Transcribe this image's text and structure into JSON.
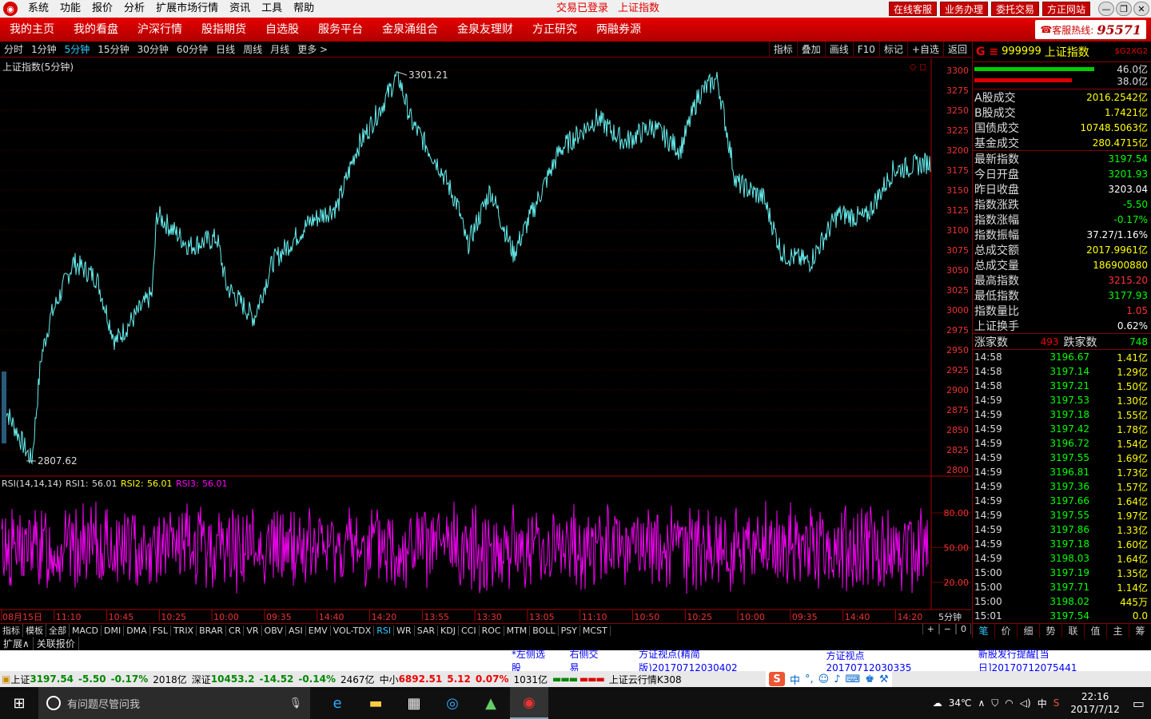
{
  "menubar": {
    "items": [
      "系统",
      "功能",
      "报价",
      "分析",
      "扩展市场行情",
      "资讯",
      "工具",
      "帮助"
    ],
    "status": "交易已登录",
    "security": "上证指数",
    "buttons": [
      "在线客服",
      "业务办理",
      "委托交易",
      "方正网站"
    ]
  },
  "navbar": {
    "items": [
      "我的主页",
      "我的看盘",
      "沪深行情",
      "股指期货",
      "自选股",
      "服务平台",
      "金泉涌组合",
      "金泉友理财",
      "方正研究",
      "两融券源"
    ],
    "hotline_label": "客服热线:",
    "hotline_num": "95571"
  },
  "periods": {
    "items": [
      "分时",
      "1分钟",
      "5分钟",
      "15分钟",
      "30分钟",
      "60分钟",
      "日线",
      "周线",
      "月线",
      "更多 >"
    ],
    "active": 2
  },
  "tools": [
    "指标",
    "叠加",
    "画线",
    "F10",
    "标记",
    "+自选",
    "返回"
  ],
  "chart_data": {
    "type": "line",
    "title": "上证指数(5分钟)",
    "y_ticks": [
      3300,
      3275,
      3250,
      3225,
      3200,
      3175,
      3150,
      3125,
      3100,
      3075,
      3050,
      3025,
      3000,
      2975,
      2950,
      2925,
      2900,
      2875,
      2850,
      2825,
      2800
    ],
    "ylim": [
      2800,
      3300
    ],
    "high_label": "3301.21",
    "low_label": "2807.62",
    "waypoints": [
      [
        0,
        2880
      ],
      [
        0.03,
        2810
      ],
      [
        0.04,
        2940
      ],
      [
        0.05,
        2990
      ],
      [
        0.075,
        3060
      ],
      [
        0.1,
        3040
      ],
      [
        0.12,
        2960
      ],
      [
        0.16,
        3020
      ],
      [
        0.165,
        3120
      ],
      [
        0.2,
        3080
      ],
      [
        0.23,
        3090
      ],
      [
        0.24,
        3030
      ],
      [
        0.27,
        2990
      ],
      [
        0.29,
        3060
      ],
      [
        0.33,
        3110
      ],
      [
        0.36,
        3130
      ],
      [
        0.38,
        3200
      ],
      [
        0.41,
        3260
      ],
      [
        0.425,
        3295
      ],
      [
        0.44,
        3235
      ],
      [
        0.47,
        3180
      ],
      [
        0.49,
        3130
      ],
      [
        0.5,
        3080
      ],
      [
        0.525,
        3150
      ],
      [
        0.55,
        3070
      ],
      [
        0.6,
        3200
      ],
      [
        0.64,
        3240
      ],
      [
        0.67,
        3210
      ],
      [
        0.7,
        3230
      ],
      [
        0.73,
        3200
      ],
      [
        0.75,
        3270
      ],
      [
        0.77,
        3290
      ],
      [
        0.79,
        3160
      ],
      [
        0.82,
        3140
      ],
      [
        0.84,
        3070
      ],
      [
        0.87,
        3060
      ],
      [
        0.9,
        3120
      ],
      [
        0.93,
        3115
      ],
      [
        0.96,
        3175
      ],
      [
        1.0,
        3185
      ]
    ],
    "x_labels": [
      "08月15日",
      "11:10",
      "10:45",
      "10:25",
      "10:00",
      "09:35",
      "14:40",
      "14:20",
      "13:55",
      "13:30",
      "13:05",
      "11:10",
      "10:50",
      "10:25",
      "10:00",
      "09:35",
      "14:40",
      "14:20"
    ],
    "x_unit": "5分钟",
    "rsi": {
      "label": "RSI(14,14,14)",
      "rsi1_label": "RSI1:",
      "rsi1": "56.01",
      "rsi2_label": "RSI2:",
      "rsi2": "56.01",
      "rsi3_label": "RSI3:",
      "rsi3": "56.01",
      "ticks": [
        "80.00",
        "50.00",
        "20.00"
      ]
    }
  },
  "quote": {
    "code": "999999",
    "name": "上证指数",
    "tag": "$G2XG2",
    "bar1": "46.0亿",
    "bar2": "38.0亿",
    "turnover": [
      [
        "A股成交",
        "2016.2542亿"
      ],
      [
        "B股成交",
        "1.7421亿"
      ],
      [
        "国债成交",
        "10748.5063亿"
      ],
      [
        "基金成交",
        "280.4715亿"
      ]
    ],
    "stats": [
      [
        "最新指数",
        "3197.54",
        "g"
      ],
      [
        "今日开盘",
        "3201.93",
        "g"
      ],
      [
        "昨日收盘",
        "3203.04",
        "w"
      ],
      [
        "指数涨跌",
        "-5.50",
        "g"
      ],
      [
        "指数涨幅",
        "-0.17%",
        "g"
      ],
      [
        "指数振幅",
        "37.27/1.16%",
        "w"
      ],
      [
        "总成交额",
        "2017.9961亿",
        "y"
      ],
      [
        "总成交量",
        "186900880",
        "y"
      ],
      [
        "最高指数",
        "3215.20",
        "r"
      ],
      [
        "最低指数",
        "3177.93",
        "g"
      ],
      [
        "指数量比",
        "1.05",
        "r"
      ],
      [
        "上证换手",
        "0.62%",
        "w"
      ]
    ],
    "up_label": "涨家数",
    "up": "493",
    "down_label": "跌家数",
    "down": "748",
    "ticks": [
      [
        "14:58",
        "3196.67",
        "1.41亿"
      ],
      [
        "14:58",
        "3197.14",
        "1.29亿"
      ],
      [
        "14:58",
        "3197.21",
        "1.50亿"
      ],
      [
        "14:59",
        "3197.53",
        "1.30亿"
      ],
      [
        "14:59",
        "3197.18",
        "1.55亿"
      ],
      [
        "14:59",
        "3197.42",
        "1.78亿"
      ],
      [
        "14:59",
        "3196.72",
        "1.54亿"
      ],
      [
        "14:59",
        "3197.55",
        "1.69亿"
      ],
      [
        "14:59",
        "3196.81",
        "1.73亿"
      ],
      [
        "14:59",
        "3197.36",
        "1.57亿"
      ],
      [
        "14:59",
        "3197.66",
        "1.64亿"
      ],
      [
        "14:59",
        "3197.55",
        "1.97亿"
      ],
      [
        "14:59",
        "3197.86",
        "1.33亿"
      ],
      [
        "14:59",
        "3197.18",
        "1.60亿"
      ],
      [
        "14:59",
        "3198.03",
        "1.64亿"
      ],
      [
        "15:00",
        "3197.19",
        "1.35亿"
      ],
      [
        "15:00",
        "3197.71",
        "1.14亿"
      ],
      [
        "15:00",
        "3198.02",
        "445万"
      ],
      [
        "15:01",
        "3197.54",
        "0.0"
      ]
    ],
    "tabs": [
      "笔",
      "价",
      "细",
      "势",
      "联",
      "值",
      "主",
      "筹"
    ]
  },
  "indicators": {
    "items": [
      "指标",
      "模板",
      "全部",
      "MACD",
      "DMI",
      "DMA",
      "FSL",
      "TRIX",
      "BRAR",
      "CR",
      "VR",
      "OBV",
      "ASI",
      "EMV",
      "VOL-TDX",
      "RSI",
      "WR",
      "SAR",
      "KDJ",
      "CCI",
      "ROC",
      "MTM",
      "BOLL",
      "PSY",
      "MCST"
    ],
    "active": 15,
    "controls": [
      "+",
      "−",
      "0"
    ]
  },
  "ext": {
    "items": [
      "扩展∧",
      "关联报价"
    ]
  },
  "news": {
    "items": [
      "*左侧选股",
      "右侧交易",
      "方证视点(精简版)20170712030402",
      "方证视点20170712030335",
      "新股发行提醒[当日]20170712075441"
    ]
  },
  "status": {
    "sh_label": "上证",
    "sh": "3197.54",
    "sh_chg": "-5.50",
    "sh_pct": "-0.17%",
    "sh_amt": "2018亿",
    "sz_label": "深证",
    "sz": "10453.2",
    "sz_chg": "-14.52",
    "sz_pct": "-0.14%",
    "sz_amt": "2467亿",
    "zx_label": "中小",
    "zx": "6892.51",
    "zx_chg": "5.12",
    "zx_pct": "0.07%",
    "zx_amt": "1031亿",
    "cloud": "上证云行情K308",
    "ime_lang": "中"
  },
  "taskbar": {
    "search_placeholder": "有问题尽管问我",
    "weather": "34℃",
    "tray_lang": "中",
    "time": "22:16",
    "date": "2017/7/12"
  }
}
